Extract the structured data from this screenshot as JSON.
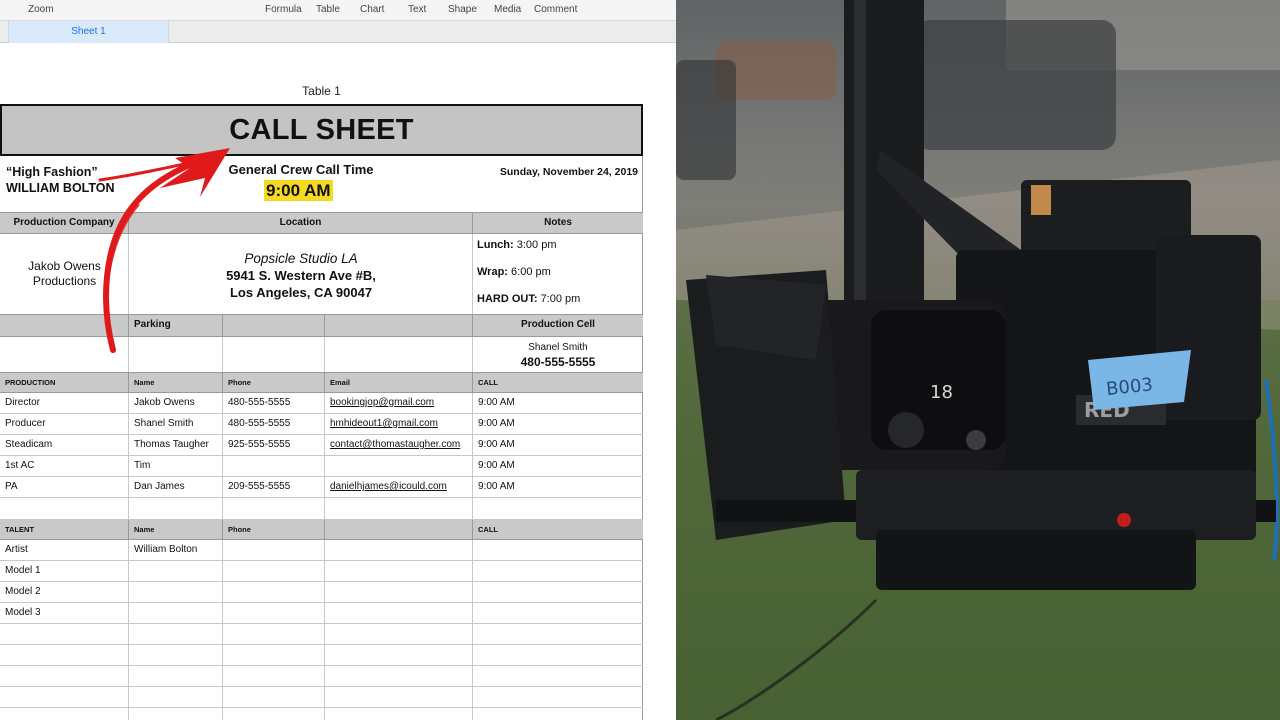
{
  "toolbar": {
    "zoom": "Zoom",
    "formula": "Formula",
    "table": "Table",
    "chart": "Chart",
    "text": "Text",
    "shape": "Shape",
    "media": "Media",
    "comment": "Comment"
  },
  "sheet_tab": "Sheet 1",
  "table_title": "Table 1",
  "call_sheet": {
    "title": "CALL SHEET",
    "show_name": "“High Fashion”",
    "artist": "WILLIAM BOLTON",
    "crew_call_label": "General Crew Call Time",
    "crew_call_time": "9:00 AM",
    "date": "Sunday, November 24, 2019",
    "headers": {
      "production_company": "Production Company",
      "location": "Location",
      "notes": "Notes",
      "parking": "Parking",
      "production_cell": "Production Cell"
    },
    "production_company": "Jakob Owens Productions",
    "location": {
      "studio": "Popsicle Studio LA",
      "street": "5941 S. Western Ave #B,",
      "city": "Los Angeles, CA 90047"
    },
    "notes": {
      "lunch_label": "Lunch:",
      "lunch_time": "3:00 pm",
      "wrap_label": "Wrap:",
      "wrap_time": "6:00 pm",
      "hardout_label": "HARD OUT:",
      "hardout_time": "7:00 pm"
    },
    "production_cell": {
      "name": "Shanel Smith",
      "phone": "480-555-5555"
    },
    "crew_headers": [
      "PRODUCTION",
      "Name",
      "Phone",
      "Email",
      "CALL"
    ],
    "crew": [
      {
        "role": "Director",
        "name": "Jakob Owens",
        "phone": "480-555-5555",
        "email": "bookingjop@gmail.com",
        "call": "9:00 AM"
      },
      {
        "role": "Producer",
        "name": "Shanel Smith",
        "phone": "480-555-5555",
        "email": "hmhideout1@gmail.com",
        "call": "9:00 AM"
      },
      {
        "role": "Steadicam",
        "name": "Thomas Taugher",
        "phone": "925-555-5555",
        "email": "contact@thomastaugher.com",
        "call": "9:00 AM"
      },
      {
        "role": "1st AC",
        "name": "Tim",
        "phone": "",
        "email": "",
        "call": "9:00 AM"
      },
      {
        "role": "PA",
        "name": "Dan James",
        "phone": "209-555-5555",
        "email": "danielhjames@icould.com",
        "call": "9:00 AM"
      }
    ],
    "talent_headers": [
      "TALENT",
      "Name",
      "Phone",
      "",
      "CALL"
    ],
    "talent": [
      {
        "role": "Artist",
        "name": "William Bolton"
      },
      {
        "role": "Model 1",
        "name": ""
      },
      {
        "role": "Model 2",
        "name": ""
      },
      {
        "role": "Model 3",
        "name": ""
      }
    ]
  },
  "photo": {
    "camera_brand": "RED",
    "tape_label": "B003",
    "lens_mark": "18"
  },
  "colors": {
    "header_gray": "#c9c9c9",
    "title_gray": "#c4c4c4",
    "highlight_yellow": "#f5d922",
    "arrow_red": "#e0191b",
    "tab_blue": "#d9eafb"
  }
}
